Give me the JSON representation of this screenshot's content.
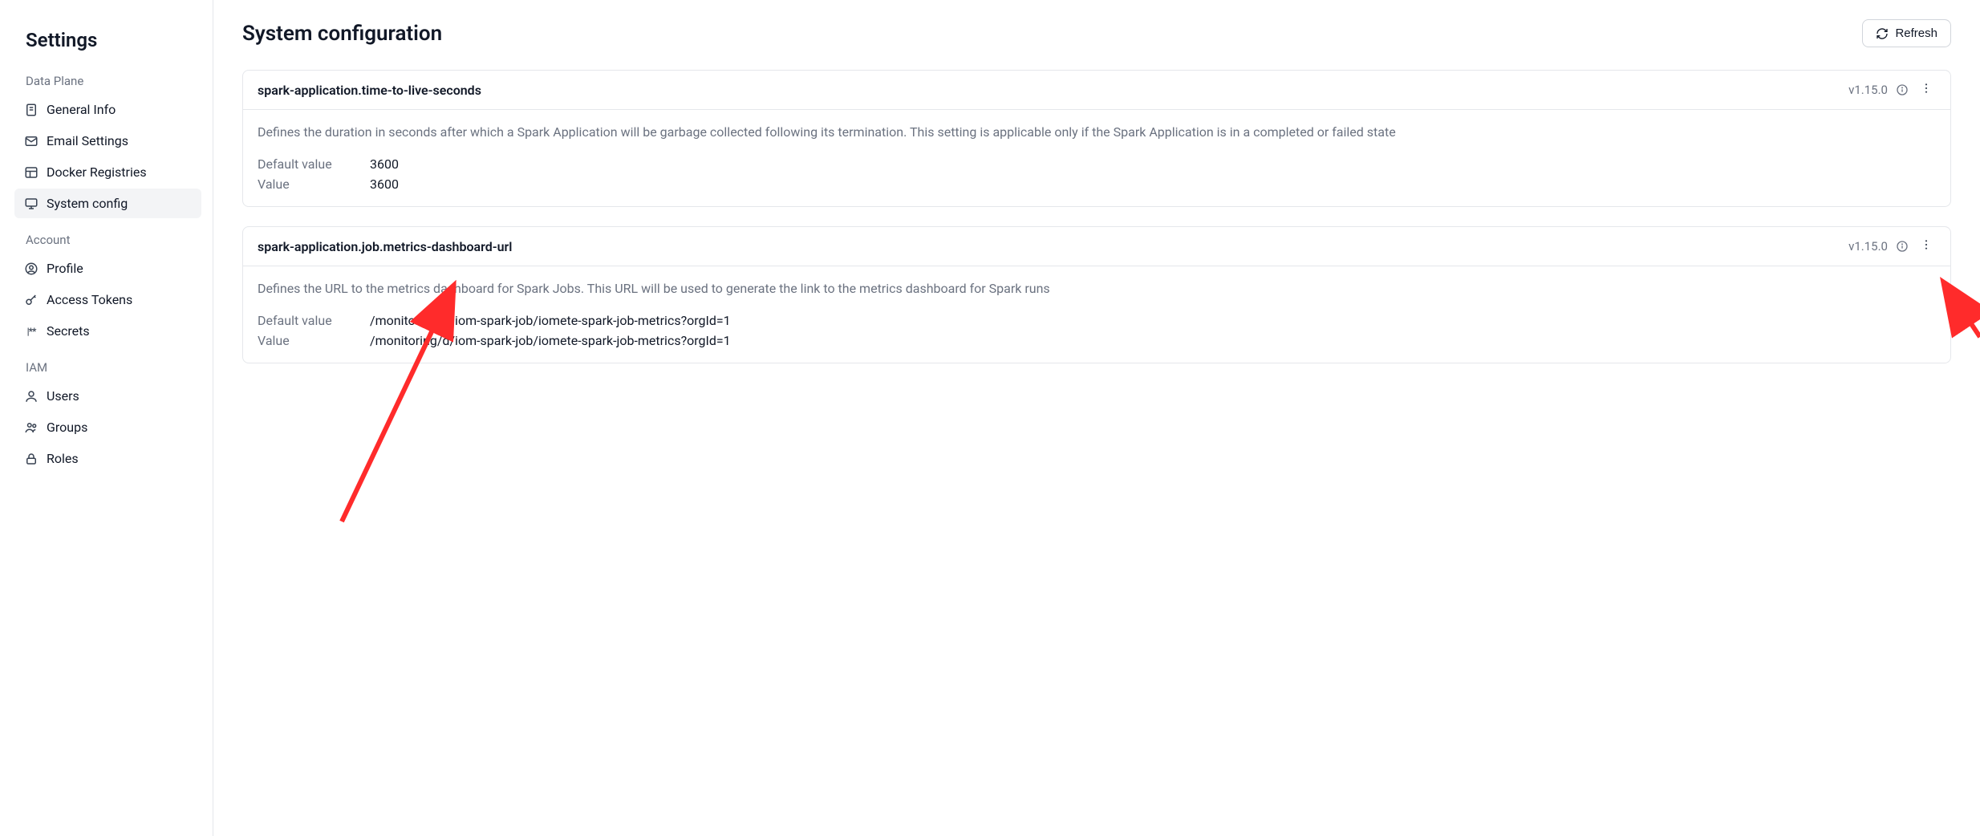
{
  "sidebar": {
    "title": "Settings",
    "sections": [
      {
        "label": "Data Plane",
        "items": [
          {
            "label": "General Info",
            "icon": "file-icon"
          },
          {
            "label": "Email Settings",
            "icon": "mail-icon"
          },
          {
            "label": "Docker Registries",
            "icon": "layout-icon"
          },
          {
            "label": "System config",
            "icon": "monitor-icon",
            "active": true
          }
        ]
      },
      {
        "label": "Account",
        "items": [
          {
            "label": "Profile",
            "icon": "user-circle-icon"
          },
          {
            "label": "Access Tokens",
            "icon": "key-icon"
          },
          {
            "label": "Secrets",
            "icon": "secret-icon"
          }
        ]
      },
      {
        "label": "IAM",
        "items": [
          {
            "label": "Users",
            "icon": "user-icon"
          },
          {
            "label": "Groups",
            "icon": "users-icon"
          },
          {
            "label": "Roles",
            "icon": "lock-icon"
          }
        ]
      }
    ]
  },
  "header": {
    "title": "System configuration",
    "refresh_label": "Refresh"
  },
  "configs": [
    {
      "name": "spark-application.time-to-live-seconds",
      "version": "v1.15.0",
      "description": "Defines the duration in seconds after which a Spark Application will be garbage collected following its termination. This setting is applicable only if the Spark Application is in a completed or failed state",
      "default_label": "Default value",
      "default_value": "3600",
      "value_label": "Value",
      "value": "3600"
    },
    {
      "name": "spark-application.job.metrics-dashboard-url",
      "version": "v1.15.0",
      "description": "Defines the URL to the metrics dashboard for Spark Jobs. This URL will be used to generate the link to the metrics dashboard for Spark runs",
      "default_label": "Default value",
      "default_value": "/monitoring/d/iom-spark-job/iomete-spark-job-metrics?orgId=1",
      "value_label": "Value",
      "value": "/monitoring/d/iom-spark-job/iomete-spark-job-metrics?orgId=1"
    }
  ]
}
